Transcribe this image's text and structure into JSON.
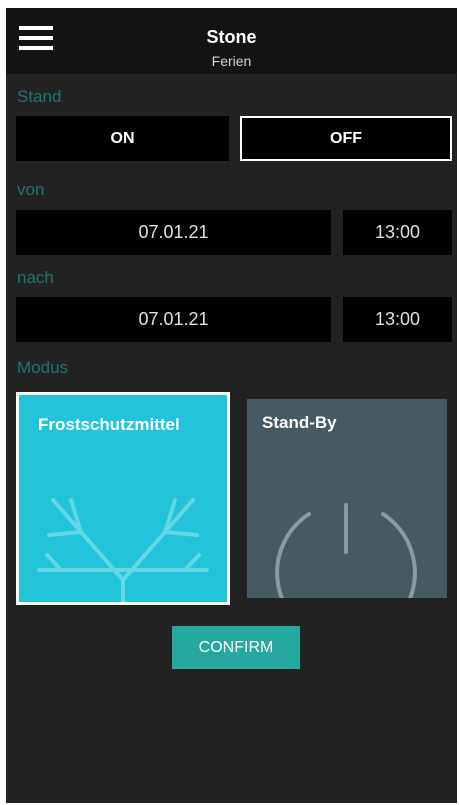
{
  "header": {
    "title": "Stone",
    "subtitle": "Ferien"
  },
  "stand": {
    "label": "Stand",
    "on_label": "ON",
    "off_label": "OFF",
    "selected": "OFF"
  },
  "von": {
    "label": "von",
    "date": "07.01.21",
    "time": "13:00"
  },
  "nach": {
    "label": "nach",
    "date": "07.01.21",
    "time": "13:00"
  },
  "modus": {
    "label": "Modus",
    "options": [
      {
        "label": "Frostschutzmittel",
        "icon": "snowflake-icon",
        "color": "#22c4dc",
        "selected": true
      },
      {
        "label": "Stand-By",
        "icon": "power-icon",
        "color": "#475a64",
        "selected": false
      }
    ]
  },
  "confirm_label": "CONFIRM",
  "colors": {
    "accent": "#25a89e",
    "section_label": "#1b7670",
    "background": "#222222"
  }
}
